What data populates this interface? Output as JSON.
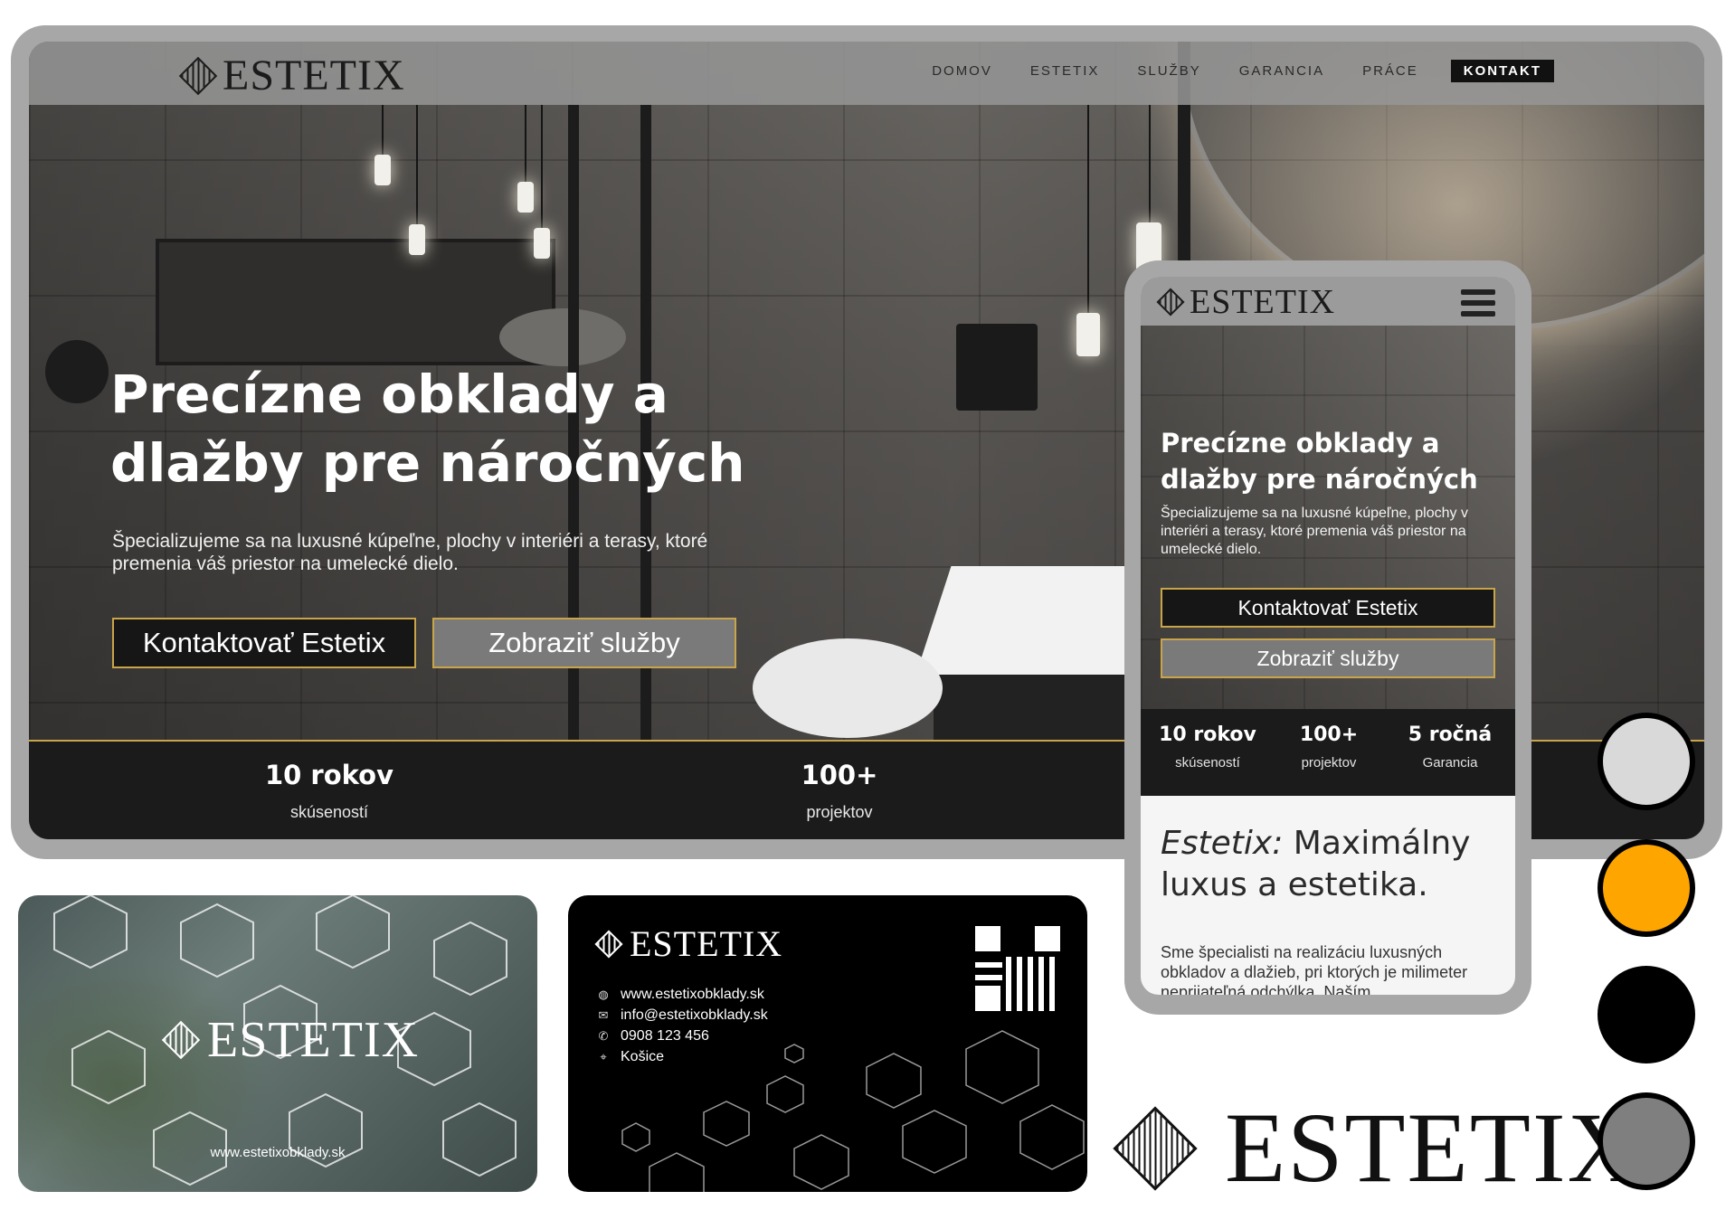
{
  "brand": {
    "name": "Estetix",
    "logo_text": "ESTETIX"
  },
  "desktop": {
    "nav": {
      "items": [
        "DOMOV",
        "ESTETIX",
        "SLUŽBY",
        "GARANCIA",
        "PRÁCE",
        "KONTAKT"
      ],
      "active": "KONTAKT"
    },
    "hero": {
      "title": "Precízne obklady a dlažby pre náročných",
      "subtitle": "Špecializujeme sa na luxusné kúpeľne, plochy v interiéri a terasy, ktoré premenia váš priestor na umelecké dielo.",
      "primary_button": "Kontaktovať Estetix",
      "secondary_button": "Zobraziť služby"
    },
    "stats": [
      {
        "value": "10 rokov",
        "label": "skúseností"
      },
      {
        "value": "100+",
        "label": "projektov"
      }
    ]
  },
  "mobile": {
    "hero": {
      "title": "Precízne obklady a dlažby pre náročných",
      "subtitle": "Špecializujeme sa na luxusné kúpeľne, plochy v interiéri a terasy, ktoré premenia váš priestor na umelecké dielo.",
      "primary_button": "Kontaktovať Estetix",
      "secondary_button": "Zobraziť služby"
    },
    "stats": [
      {
        "value": "10 rokov",
        "label": "skúseností"
      },
      {
        "value": "100+",
        "label": "projektov"
      },
      {
        "value": "5 ročná",
        "label": "Garancia"
      }
    ],
    "section": {
      "heading_italic": "Estetix:",
      "heading_rest": " Maximálny luxus a estetika.",
      "body": "Sme špecialisti na realizáciu luxusných obkladov a dlažieb, pri ktorých je milimeter neprijateľná odchýlka. Naším"
    }
  },
  "business_card_front": {
    "url": "www.estetixobklady.sk"
  },
  "business_card_back": {
    "website": "www.estetixobklady.sk",
    "email": "info@estetixobklady.sk",
    "phone": "0908 123 456",
    "city": "Košice"
  },
  "palette": [
    "#d9d9d9",
    "#ffa500",
    "#000000",
    "#7f7f7f"
  ]
}
